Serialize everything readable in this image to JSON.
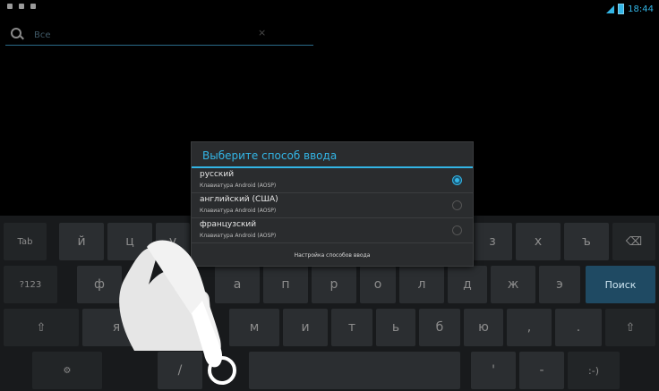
{
  "status_bar": {
    "time": "18:44"
  },
  "search": {
    "placeholder": "Все",
    "clear_symbol": "×"
  },
  "dialog": {
    "title": "Выберите способ ввода",
    "options": [
      {
        "name": "русский",
        "sub": "Клавиатура Android (AOSP)",
        "selected": true
      },
      {
        "name": "английский (США)",
        "sub": "Клавиатура Android (AOSP)",
        "selected": false
      },
      {
        "name": "французский",
        "sub": "Клавиатура Android (AOSP)",
        "selected": false
      }
    ],
    "settings_label": "Настройка способов ввода"
  },
  "keyboard": {
    "row1": {
      "tab": "Tab",
      "k1": "й",
      "k2": "ц",
      "k3": "у",
      "k9": "з",
      "k10": "х",
      "k11": "ъ",
      "backspace": "⌫"
    },
    "row2": {
      "sym": "?123",
      "k1": "ф",
      "k4": "а",
      "k5": "п",
      "k6": "р",
      "k7": "о",
      "k8": "л",
      "k9": "д",
      "k10": "ж",
      "k11": "э",
      "search": "Поиск"
    },
    "row3": {
      "shift_l": "⇧",
      "k1": "я",
      "k4": "м",
      "k5": "и",
      "k6": "т",
      "k7": "ь",
      "k8": "б",
      "k9": "ю",
      "k10": ",",
      "k11": ".",
      "shift_r": "⇧"
    },
    "row4": {
      "settings": "⚙",
      "k2": "/",
      "space": "",
      "k10": "'",
      "k11": "-",
      "smiley": ":-)"
    }
  },
  "colors": {
    "accent": "#33b5e5",
    "key": "#2b2e31",
    "background": "#000000"
  }
}
